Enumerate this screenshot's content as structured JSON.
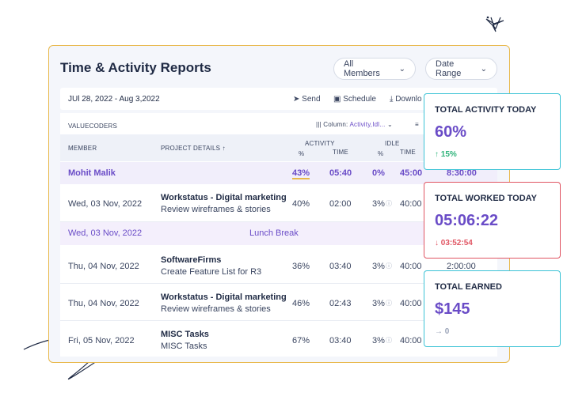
{
  "header": {
    "title": "Time & Activity Reports",
    "members_filter": "All Members",
    "date_filter": "Date Range"
  },
  "toolbar": {
    "date_range": "JUl 28, 2022 - Aug 3,2022",
    "send": "Send",
    "schedule": "Schedule",
    "download": "Downlo"
  },
  "table": {
    "org": "VALUECODERS",
    "column_label": "Column:",
    "column_value": "Activity,Idl...",
    "headers": {
      "member": "MEMBER",
      "project": "PROJECT DETAILS",
      "activity": "ACTIVITY",
      "idle": "IDLE",
      "pct": "%",
      "time": "TIME"
    },
    "summary": {
      "name": "Mohit Malik",
      "activity_pct": "43%",
      "activity_time": "05:40",
      "idle_pct": "0%",
      "idle_time": "45:00",
      "total": "8:30:00"
    },
    "rows": [
      {
        "date": "Wed, 03 Nov, 2022",
        "project": "Workstatus - Digital marketing",
        "task": "Review wireframes & stories",
        "pct": "40%",
        "time": "02:00",
        "idle_pct": "3%",
        "idle_time": "40:00",
        "total": ""
      },
      {
        "date": "Thu, 04 Nov, 2022",
        "project": "SoftwareFirms",
        "task": "Create Feature List for R3",
        "pct": "36%",
        "time": "03:40",
        "idle_pct": "3%",
        "idle_time": "40:00",
        "total": "2:00:00"
      },
      {
        "date": "Thu, 04 Nov, 2022",
        "project": "Workstatus - Digital marketing",
        "task": "Review wireframes & stories",
        "pct": "46%",
        "time": "02:43",
        "idle_pct": "3%",
        "idle_time": "40:00",
        "total": ""
      },
      {
        "date": "Fri, 05 Nov, 2022",
        "project": "MISC Tasks",
        "task": "MISC Tasks",
        "pct": "67%",
        "time": "03:40",
        "idle_pct": "3%",
        "idle_time": "40:00",
        "total": ""
      }
    ],
    "break_row": {
      "date": "Wed, 03 Nov, 2022",
      "label": "Lunch Break"
    }
  },
  "stats": [
    {
      "label": "TOTAL ACTIVITY TODAY",
      "value": "60%",
      "delta": "15%",
      "trend": "up"
    },
    {
      "label": "TOTAL WORKED TODAY",
      "value": "05:06:22",
      "delta": "03:52:54",
      "trend": "down"
    },
    {
      "label": "TOTAL EARNED",
      "value": "$145",
      "delta": "0",
      "trend": "flat"
    }
  ],
  "colors": {
    "accent": "#6a4cc7",
    "border_card": "#e8b84a",
    "teal": "#3cc3d6",
    "red": "#e05563",
    "green": "#2fb37a"
  }
}
